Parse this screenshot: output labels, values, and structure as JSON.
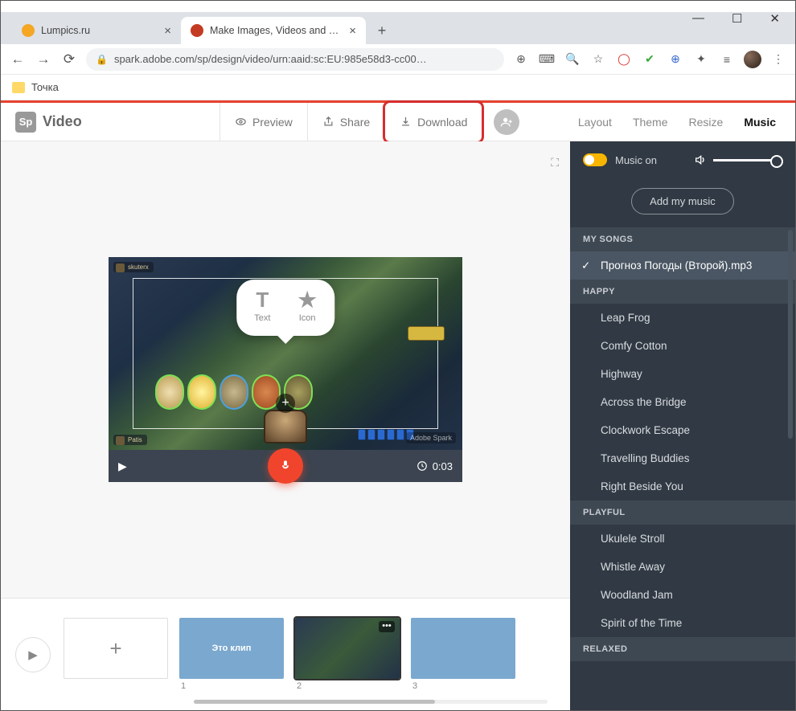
{
  "window": {
    "minimize": "—",
    "maximize": "☐",
    "close": "✕"
  },
  "tabs": {
    "items": [
      {
        "title": "Lumpics.ru",
        "fav": "#f5a623"
      },
      {
        "title": "Make Images, Videos and Web S",
        "fav": "#c23b22"
      }
    ],
    "new": "+"
  },
  "addr": {
    "url": "spark.adobe.com/sp/design/video/urn:aaid:sc:EU:985e58d3-cc00…"
  },
  "bookmarks": {
    "item": "Точка"
  },
  "brand": {
    "sp": "Sp",
    "name": "Video"
  },
  "toolbar": {
    "preview": "Preview",
    "share": "Share",
    "download": "Download"
  },
  "rightnav": {
    "layout": "Layout",
    "theme": "Theme",
    "resize": "Resize",
    "music": "Music"
  },
  "stage": {
    "bubble": {
      "text_big": "T",
      "text_lbl": "Text",
      "icon_big": "★",
      "icon_lbl": "Icon"
    },
    "nameplate1": "skuterx",
    "nameplate2": "Patis",
    "watermark": "Adobe Spark",
    "time": "0:03"
  },
  "timeline": {
    "clip1_label": "Это клип",
    "nums": [
      "",
      "1",
      "2",
      "3"
    ]
  },
  "panel": {
    "music_on": "Music on",
    "add": "Add my music",
    "sections": {
      "my": "MY SONGS",
      "happy": "HAPPY",
      "playful": "PLAYFUL",
      "relaxed": "RELAXED"
    },
    "my_songs": [
      "Прогноз Погоды (Второй).mp3"
    ],
    "happy": [
      "Leap Frog",
      "Comfy Cotton",
      "Highway",
      "Across the Bridge",
      "Clockwork Escape",
      "Travelling Buddies",
      "Right Beside You"
    ],
    "playful": [
      "Ukulele Stroll",
      "Whistle Away",
      "Woodland Jam",
      "Spirit of the Time"
    ]
  }
}
